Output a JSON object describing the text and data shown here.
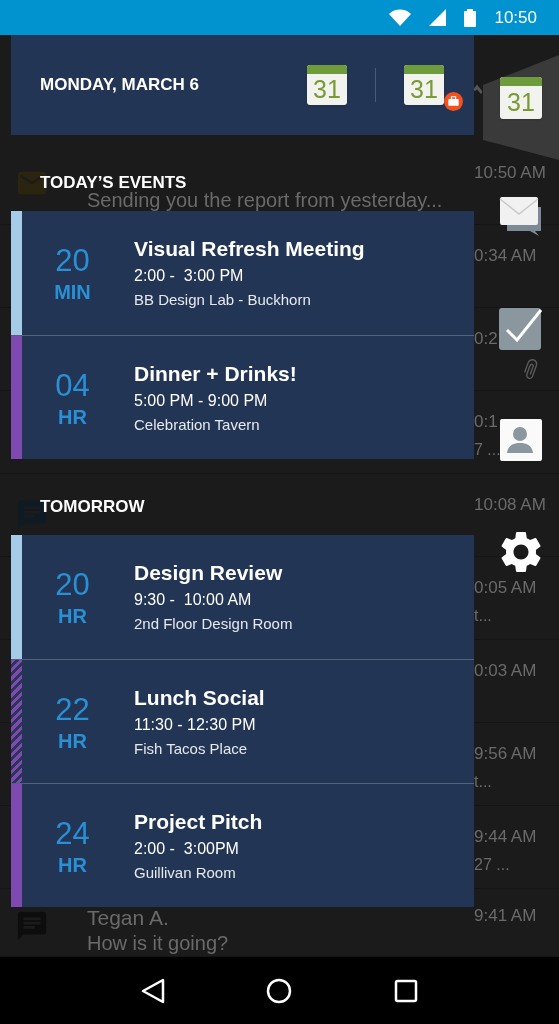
{
  "status_bar": {
    "time": "10:50"
  },
  "background_list": [
    {
      "kind": "email",
      "snippet": "Sending you the report from yesterday...",
      "time": "10:50 AM",
      "attachment": false
    },
    {
      "kind": "plain",
      "time": "0:34 AM",
      "attachment": false
    },
    {
      "kind": "plain",
      "time": "0:2",
      "attachment": true
    },
    {
      "kind": "plain",
      "time": "0:1",
      "tail": "7 ...",
      "attachment": false
    },
    {
      "kind": "bbm",
      "time": "10:08 AM",
      "attachment": false
    },
    {
      "kind": "plain",
      "time": "0:05 AM",
      "tail": "t...",
      "attachment": false
    },
    {
      "kind": "plain",
      "time": "0:03 AM",
      "attachment": false
    },
    {
      "kind": "plain",
      "time": "9:56 AM",
      "tail": "t...",
      "attachment": false
    },
    {
      "kind": "plain",
      "time": "9:44 AM",
      "tail": "27 ...",
      "attachment": false
    },
    {
      "kind": "chat",
      "name": "Tegan A.",
      "snippet": "How is it going?",
      "time": "9:41 AM",
      "attachment": false
    }
  ],
  "dock": [
    {
      "kind": "calendar",
      "label": "31",
      "selected": true
    },
    {
      "kind": "email",
      "selected": false
    },
    {
      "kind": "tasks",
      "selected": false
    },
    {
      "kind": "contacts",
      "selected": false
    },
    {
      "kind": "settings",
      "selected": false
    }
  ],
  "header": {
    "date": "MONDAY, MARCH 6",
    "calendars": [
      {
        "label": "31",
        "work": false
      },
      {
        "label": "31",
        "work": true
      }
    ]
  },
  "sections": [
    {
      "title": "TODAY’S EVENTS",
      "events": [
        {
          "countdown": "20",
          "unit": "MIN",
          "title": "Visual Refresh Meeting",
          "time": "2:00 -  3:00 PM",
          "location": "BB Design Lab - Buckhorn",
          "color": "#a6cbe9",
          "kind": "solid"
        },
        {
          "countdown": "04",
          "unit": "HR",
          "title": "Dinner + Drinks!",
          "time": "5:00 PM - 9:00 PM",
          "location": "Celebration Tavern",
          "color": "#7e4ab0",
          "kind": "solid"
        }
      ]
    },
    {
      "title": "TOMORROW",
      "events": [
        {
          "countdown": "20",
          "unit": "HR",
          "title": "Design Review",
          "time": "9:30 -  10:00 AM",
          "location": "2nd Floor Design Room",
          "color": "#a6cbe9",
          "kind": "solid"
        },
        {
          "countdown": "22",
          "unit": "HR",
          "title": "Lunch Social",
          "time": "11:30 - 12:30 PM",
          "location": "Fish Tacos Place",
          "color": "#7e4ab0",
          "kind": "hatched"
        },
        {
          "countdown": "24",
          "unit": "HR",
          "title": "Project Pitch",
          "time": "2:00 -  3:00PM",
          "location": "Guillivan Room",
          "color": "#7e4ab0",
          "kind": "solid"
        }
      ]
    }
  ]
}
